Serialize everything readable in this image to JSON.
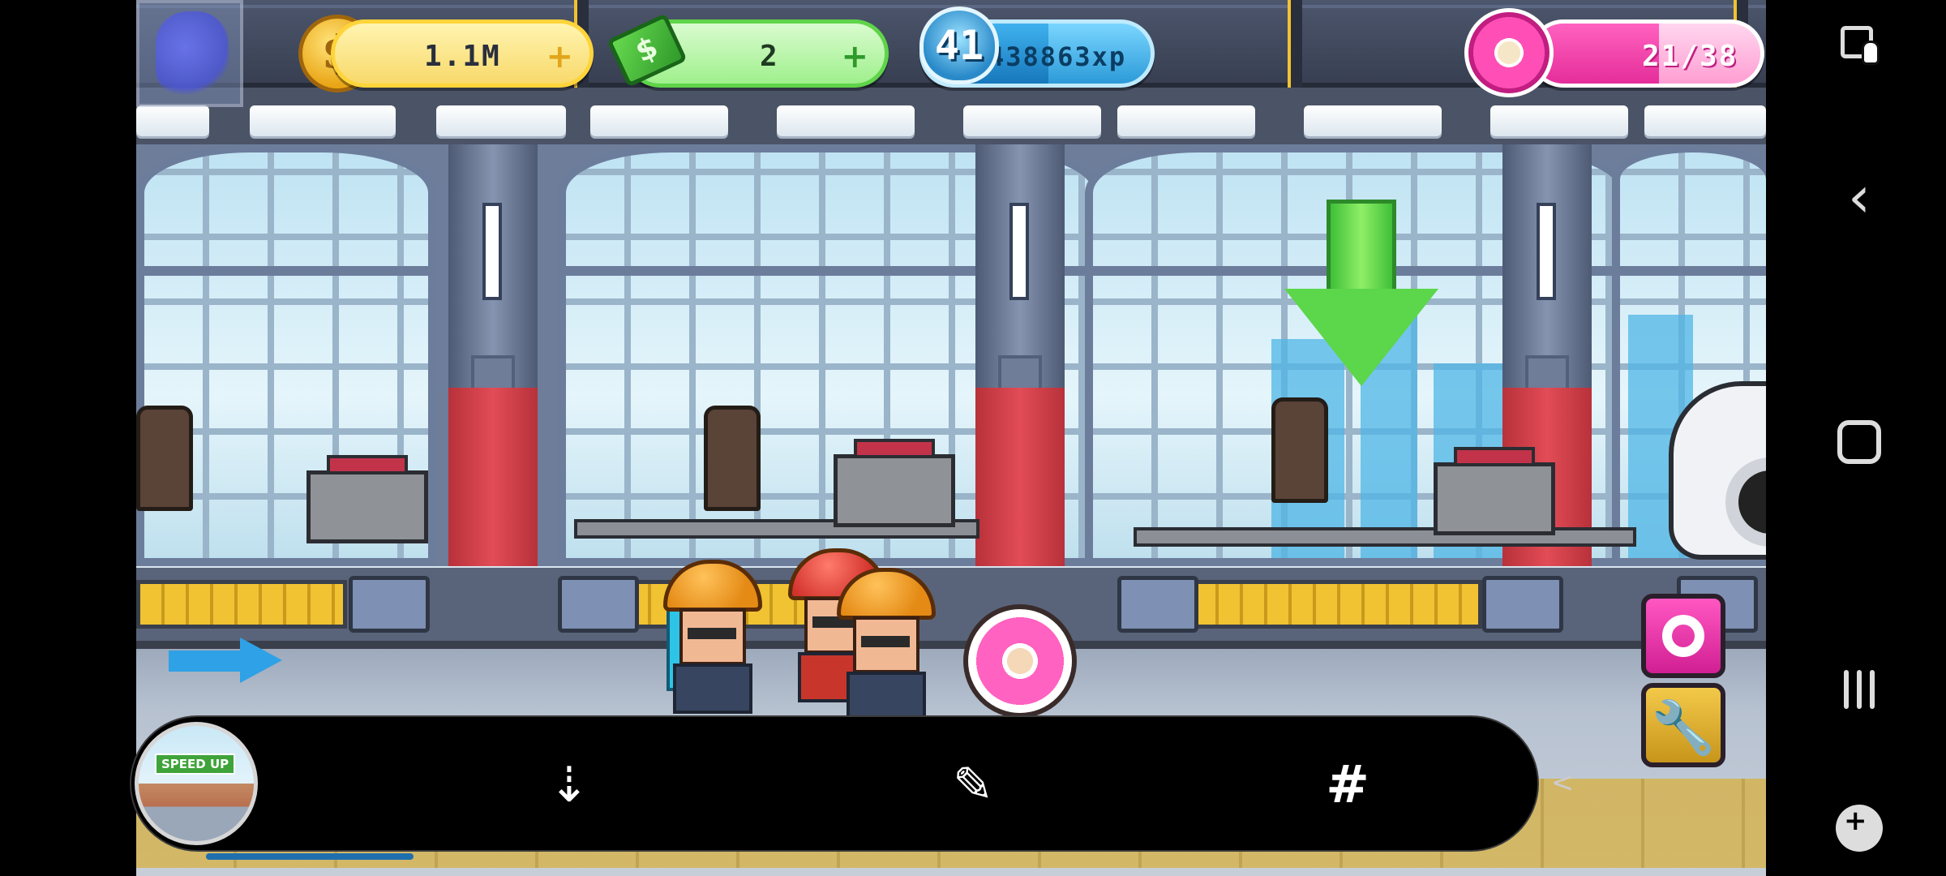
{
  "hud": {
    "coins": "1.1M",
    "cash": "2",
    "level": "41",
    "xp": "438863xp",
    "donuts": "21/38",
    "coin_glyph": "$",
    "cash_glyph": "$",
    "plus_glyph": "+"
  },
  "buttons": {
    "wrench_glyph": "🔧"
  },
  "toolbar": {
    "thumbnail_badge": "SPEED UP",
    "scroll_capture_glyph": "⇣",
    "crop_edit_glyph": "✎",
    "tag_glyph": "#",
    "share_glyph": "<"
  },
  "navbar": {
    "back_glyph": "‹"
  },
  "colors": {
    "coin": "#f8d96b",
    "cash": "#9ff08c",
    "xp": "#2c9ad8",
    "donut": "#ff62c0"
  },
  "progress": {
    "xp_fraction": 0.55,
    "donuts_fraction": 0.553
  }
}
